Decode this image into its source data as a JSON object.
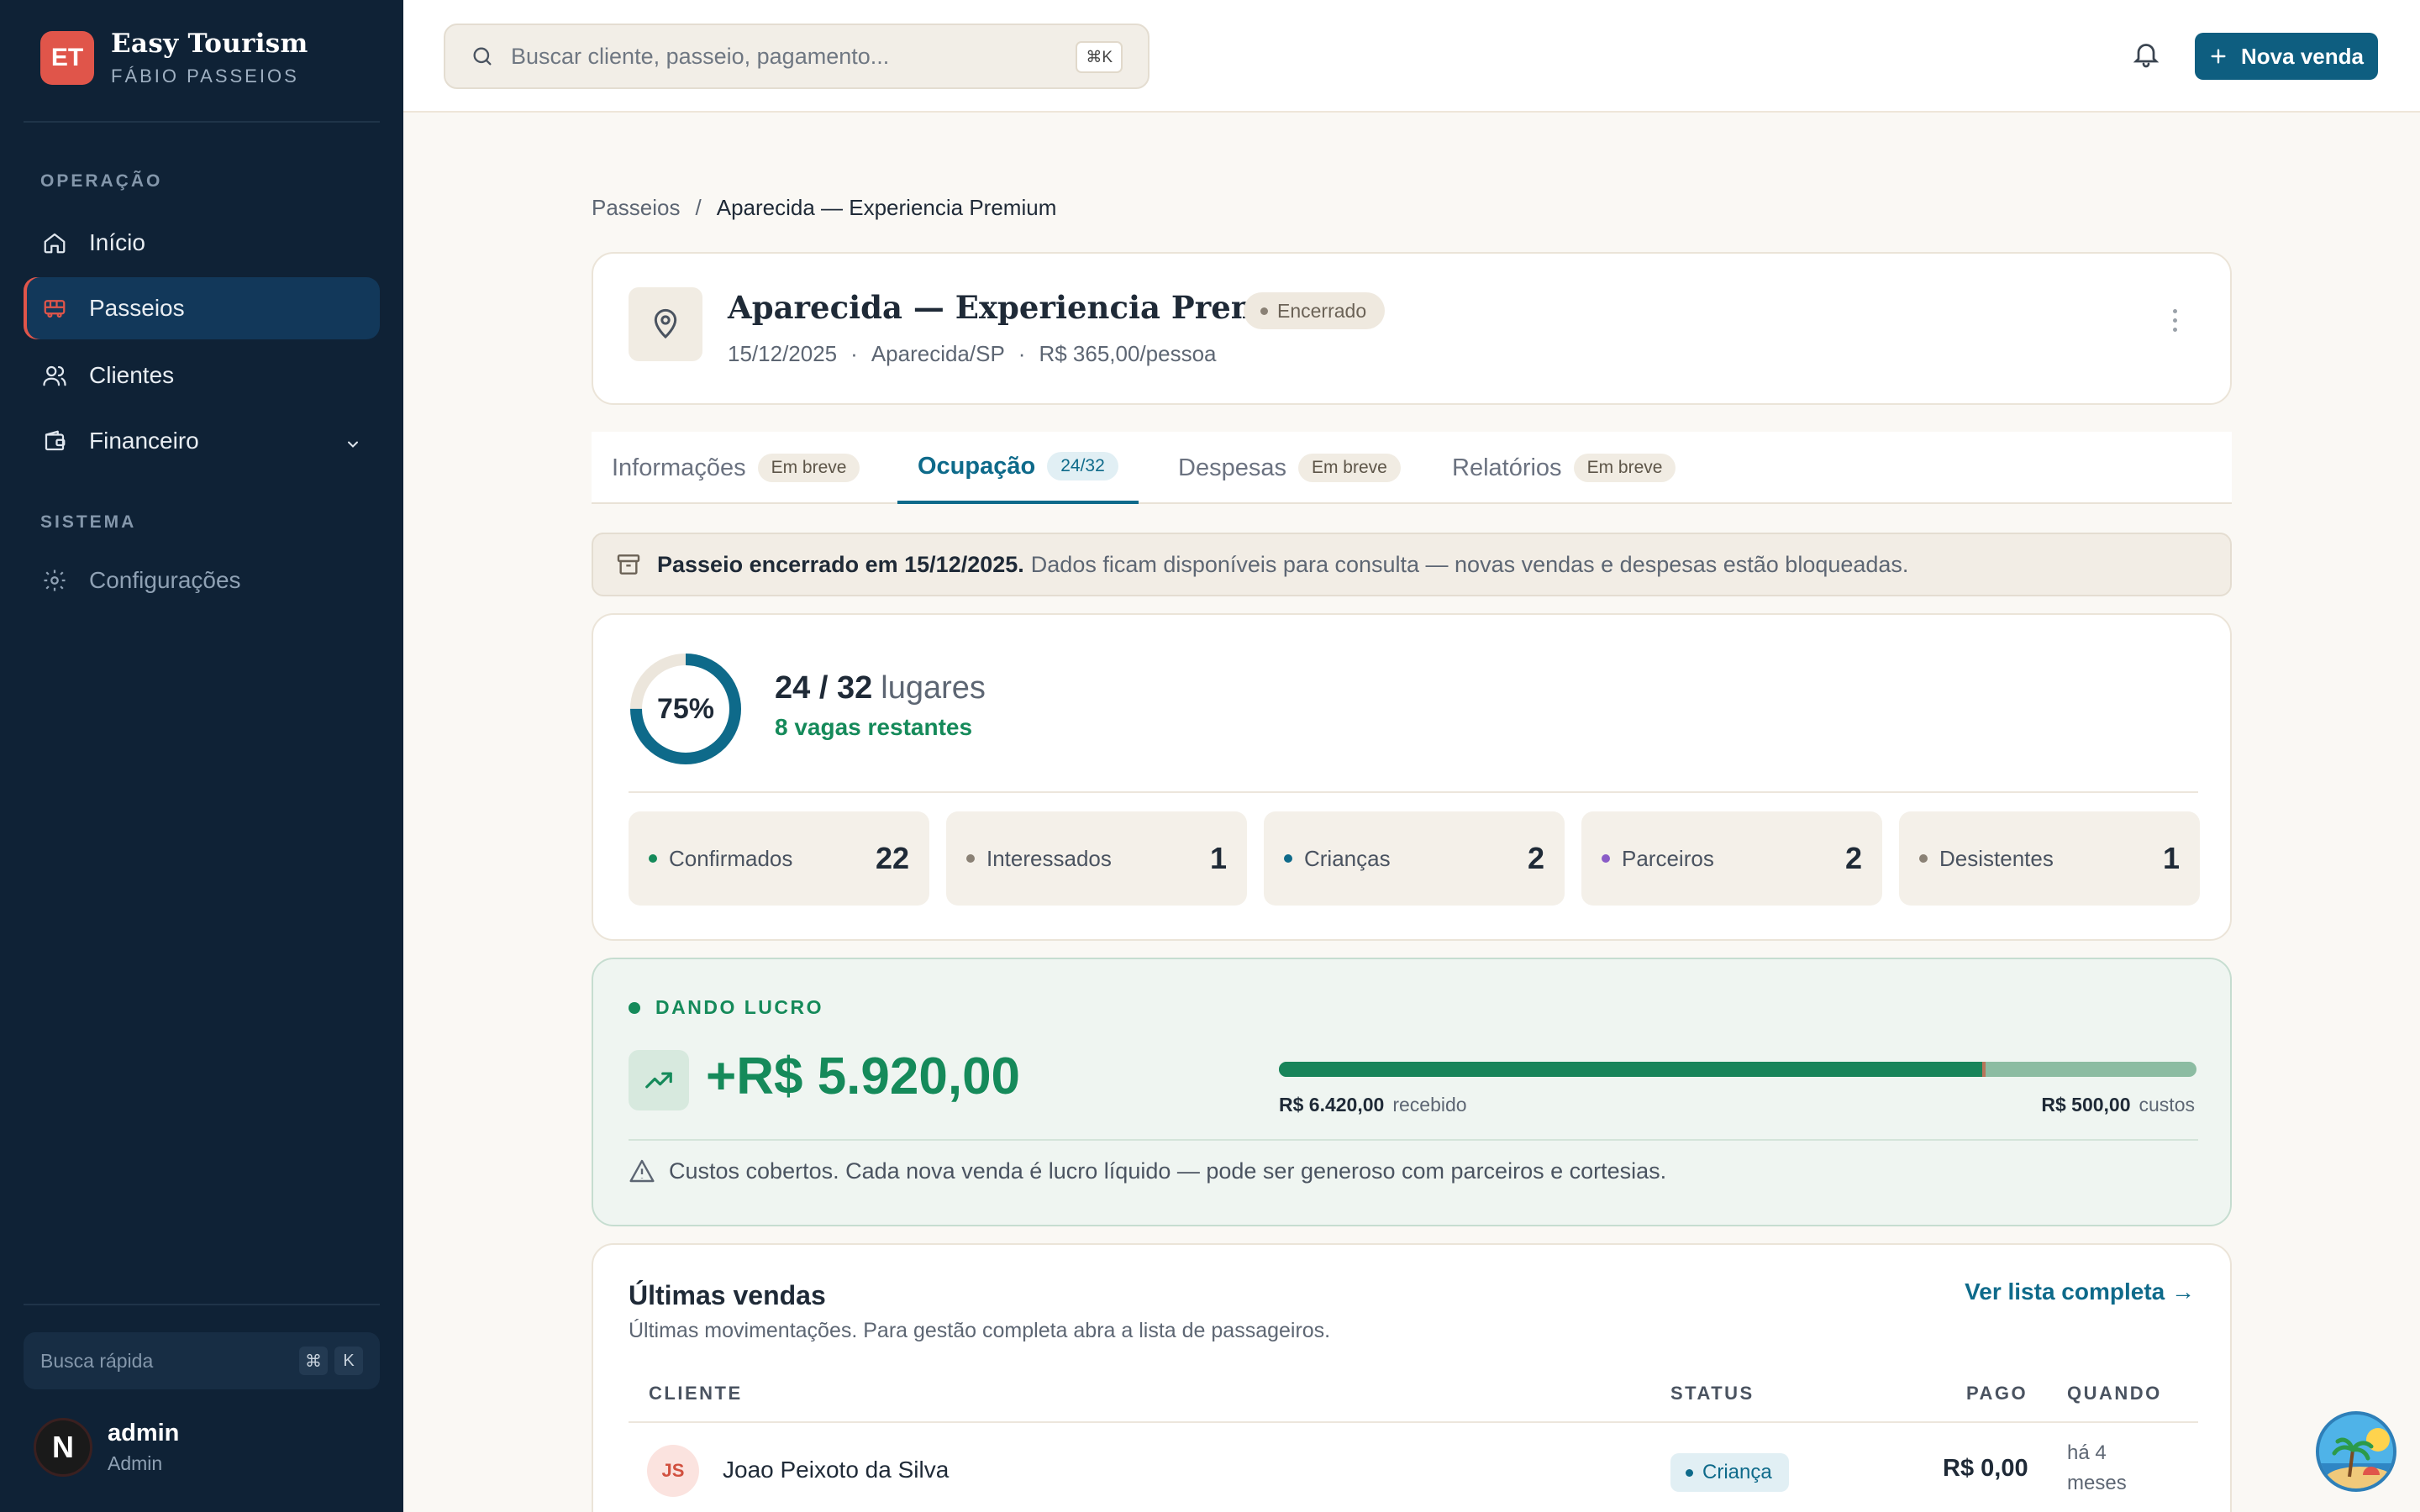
{
  "brand": {
    "initials": "ET",
    "name": "Easy Tourism",
    "subtitle": "FÁBIO PASSEIOS"
  },
  "sidebar": {
    "section_operacao": "OPERAÇÃO",
    "section_sistema": "SISTEMA",
    "items": [
      {
        "label": "Início",
        "icon": "home-icon"
      },
      {
        "label": "Passeios",
        "icon": "bus-icon",
        "active": true
      },
      {
        "label": "Clientes",
        "icon": "users-icon"
      },
      {
        "label": "Financeiro",
        "icon": "wallet-icon"
      },
      {
        "label": "Configurações",
        "icon": "gear-icon"
      }
    ],
    "quick_search": "Busca rápida",
    "quick_keys": [
      "⌘",
      "K"
    ],
    "user": {
      "initial": "N",
      "name": "admin",
      "role": "Admin"
    }
  },
  "topbar": {
    "search_placeholder": "Buscar cliente, passeio, pagamento...",
    "search_kbd": "⌘K",
    "new_sale": "Nova venda"
  },
  "breadcrumb": {
    "root": "Passeios",
    "sep": "/",
    "current": "Aparecida — Experiencia Premium"
  },
  "tour": {
    "title": "Aparecida — Experiencia Premium",
    "status": "Encerrado",
    "date": "15/12/2025",
    "place": "Aparecida/SP",
    "price": "R$ 365,00/pessoa",
    "sep": "·"
  },
  "tabs": [
    {
      "label": "Informações",
      "tag": "Em breve"
    },
    {
      "label": "Ocupação",
      "tag": "24/32",
      "active": true
    },
    {
      "label": "Despesas",
      "tag": "Em breve"
    },
    {
      "label": "Relatórios",
      "tag": "Em breve"
    }
  ],
  "banner": {
    "bold": "Passeio encerrado em 15/12/2025.",
    "text": "Dados ficam disponíveis para consulta — novas vendas e despesas estão bloqueadas."
  },
  "occupancy": {
    "percent_label": "75%",
    "percent": 0.75,
    "taken": "24",
    "slash": "/",
    "total": "32",
    "word": "lugares",
    "remaining": "8 vagas restantes",
    "stats": [
      {
        "label": "Confirmados",
        "value": "22",
        "color": "#158a5a"
      },
      {
        "label": "Interessados",
        "value": "1",
        "color": "#8a8175"
      },
      {
        "label": "Crianças",
        "value": "2",
        "color": "#0e6a8a"
      },
      {
        "label": "Parceiros",
        "value": "2",
        "color": "#8a5cc7"
      },
      {
        "label": "Desistentes",
        "value": "1",
        "color": "#8a8175"
      }
    ]
  },
  "profit": {
    "label": "DANDO LUCRO",
    "value": "+R$ 5.920,00",
    "received_value": "R$ 6.420,00",
    "received_label": "recebido",
    "costs_value": "R$ 500,00",
    "costs_label": "custos",
    "received_share": 0.7697,
    "note": "Custos cobertos. Cada nova venda é lucro líquido — pode ser generoso com parceiros e cortesias."
  },
  "sales": {
    "title": "Últimas vendas",
    "subtitle": "Últimas movimentações. Para gestão completa abra a lista de passageiros.",
    "link": "Ver lista completa →",
    "columns": {
      "client": "CLIENTE",
      "status": "STATUS",
      "paid": "PAGO",
      "when": "QUANDO"
    },
    "rows": [
      {
        "initials": "JS",
        "name": "Joao Peixoto da Silva",
        "status": "Criança",
        "paid": "R$ 0,00",
        "when": "há 4 meses"
      }
    ]
  },
  "colors": {
    "accent": "#0e5e80",
    "brand": "#e0554a",
    "success": "#158a5a",
    "sidebar": "#0f2236"
  }
}
